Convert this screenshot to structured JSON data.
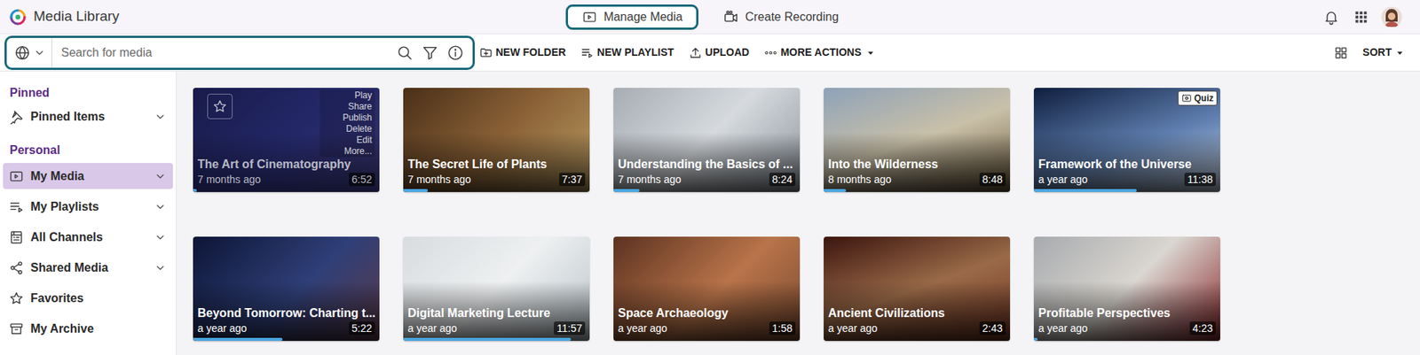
{
  "app": {
    "title": "Media Library"
  },
  "nav_tabs": [
    {
      "label": "Manage Media",
      "selected": true
    },
    {
      "label": "Create Recording",
      "selected": false
    }
  ],
  "search": {
    "placeholder": "Search for media",
    "focused": true
  },
  "actions": [
    {
      "label": "NEW FOLDER",
      "dropdown": false
    },
    {
      "label": "NEW PLAYLIST",
      "dropdown": false
    },
    {
      "label": "UPLOAD",
      "dropdown": false
    },
    {
      "label": "MORE ACTIONS",
      "dropdown": true
    }
  ],
  "sort": {
    "label": "SORT"
  },
  "sidebar": {
    "sections": [
      {
        "heading": "Pinned",
        "items": [
          {
            "label": "Pinned Items",
            "expandable": true,
            "selected": false
          }
        ]
      },
      {
        "heading": "Personal",
        "items": [
          {
            "label": "My Media",
            "expandable": true,
            "selected": true
          },
          {
            "label": "My Playlists",
            "expandable": true,
            "selected": false
          },
          {
            "label": "All Channels",
            "expandable": true,
            "selected": false
          },
          {
            "label": "Shared Media",
            "expandable": true,
            "selected": false
          },
          {
            "label": "Favorites",
            "expandable": false,
            "selected": false
          },
          {
            "label": "My Archive",
            "expandable": false,
            "selected": false
          }
        ]
      }
    ]
  },
  "media": [
    {
      "title": "The Art of Cinematography",
      "age": "7 months ago",
      "duration": "6:52",
      "level": 0.02,
      "hovered": true,
      "hover_menu": [
        "Play",
        "Share",
        "Publish",
        "Delete",
        "Edit",
        "More..."
      ]
    },
    {
      "title": "The Secret Life of Plants",
      "age": "7 months ago",
      "duration": "7:37",
      "level": 0.13,
      "hovered": false
    },
    {
      "title": "Understanding the Basics of ...",
      "age": "7 months ago",
      "duration": "8:24",
      "level": 0.14,
      "hovered": false
    },
    {
      "title": "Into the Wilderness",
      "age": "8 months ago",
      "duration": "8:48",
      "level": 0.12,
      "hovered": false
    },
    {
      "title": "Framework of the Universe",
      "age": "a year ago",
      "duration": "11:38",
      "level": 0.55,
      "hovered": false,
      "badge": "Quiz"
    },
    {
      "title": "Beyond Tomorrow: Charting t...",
      "age": "a year ago",
      "duration": "5:22",
      "level": 0.48,
      "hovered": false
    },
    {
      "title": "Digital Marketing Lecture",
      "age": "a year ago",
      "duration": "11:57",
      "level": 0.9,
      "hovered": false
    },
    {
      "title": "Space Archaeology",
      "age": "a year ago",
      "duration": "1:58",
      "level": 0,
      "hovered": false
    },
    {
      "title": "Ancient Civilizations",
      "age": "a year ago",
      "duration": "2:43",
      "level": 0,
      "hovered": false
    },
    {
      "title": "Profitable Perspectives",
      "age": "a year ago",
      "duration": "4:23",
      "level": 0.02,
      "hovered": false
    }
  ]
}
